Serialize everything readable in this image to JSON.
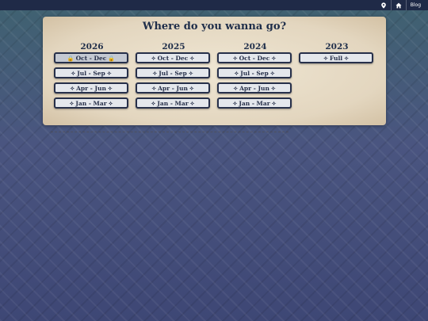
{
  "topbar": {
    "items": [
      {
        "icon": "location-pin-icon"
      },
      {
        "icon": "home-icon"
      },
      {
        "label": "Blog"
      }
    ]
  },
  "panel": {
    "title": "Where do you wanna go?",
    "columns": [
      {
        "year": "2026",
        "buttons": [
          {
            "label": "Oct - Dec",
            "symbol": "🔒",
            "locked": true
          }
        ]
      },
      {
        "year": "2025",
        "buttons": [
          {
            "label": "Oct - Dec",
            "symbol": "✧"
          },
          {
            "label": "Jul - Sep",
            "symbol": "✧"
          },
          {
            "label": "Apr - Jun",
            "symbol": "✧"
          },
          {
            "label": "Jan - Mar",
            "symbol": "✧"
          }
        ]
      },
      {
        "year": "2024",
        "buttons": [
          {
            "label": "Oct - Dec",
            "symbol": "✧"
          },
          {
            "label": "Jul - Sep",
            "symbol": "✧"
          },
          {
            "label": "Apr - Jun",
            "symbol": "✧"
          },
          {
            "label": "Jan - Mar",
            "symbol": "✧"
          }
        ]
      },
      {
        "year": "2023",
        "buttons": [
          {
            "label": "Full",
            "symbol": "✧"
          }
        ]
      }
    ],
    "col2026_extra": [
      {
        "label": "Jul - Sep",
        "symbol": "✧"
      },
      {
        "label": "Apr - Jun",
        "symbol": "✧"
      },
      {
        "label": "Jan - Mar",
        "symbol": "✧"
      }
    ]
  }
}
